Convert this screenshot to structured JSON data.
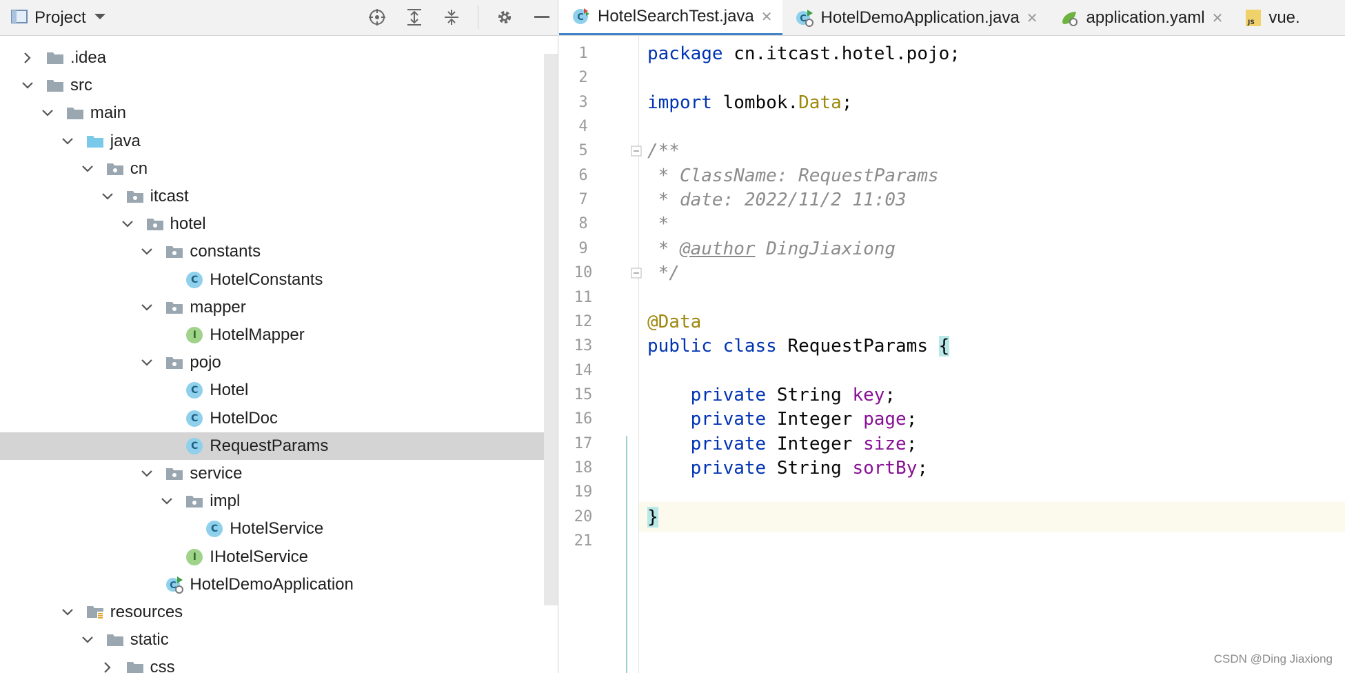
{
  "project_panel": {
    "title": "Project",
    "tree": [
      {
        "label": ".idea",
        "depth": 0,
        "expanded": false,
        "icon": "folder-icon"
      },
      {
        "label": "src",
        "depth": 0,
        "expanded": true,
        "icon": "folder-icon"
      },
      {
        "label": "main",
        "depth": 1,
        "expanded": true,
        "icon": "folder-icon"
      },
      {
        "label": "java",
        "depth": 2,
        "expanded": true,
        "icon": "source-folder-icon"
      },
      {
        "label": "cn",
        "depth": 3,
        "expanded": true,
        "icon": "package-icon"
      },
      {
        "label": "itcast",
        "depth": 4,
        "expanded": true,
        "icon": "package-icon"
      },
      {
        "label": "hotel",
        "depth": 5,
        "expanded": true,
        "icon": "package-icon"
      },
      {
        "label": "constants",
        "depth": 6,
        "expanded": true,
        "icon": "package-icon"
      },
      {
        "label": "HotelConstants",
        "depth": 7,
        "expanded": null,
        "icon": "class-icon"
      },
      {
        "label": "mapper",
        "depth": 6,
        "expanded": true,
        "icon": "package-icon"
      },
      {
        "label": "HotelMapper",
        "depth": 7,
        "expanded": null,
        "icon": "interface-icon"
      },
      {
        "label": "pojo",
        "depth": 6,
        "expanded": true,
        "icon": "package-icon"
      },
      {
        "label": "Hotel",
        "depth": 7,
        "expanded": null,
        "icon": "class-icon"
      },
      {
        "label": "HotelDoc",
        "depth": 7,
        "expanded": null,
        "icon": "class-icon"
      },
      {
        "label": "RequestParams",
        "depth": 7,
        "expanded": null,
        "icon": "class-icon",
        "selected": true
      },
      {
        "label": "service",
        "depth": 6,
        "expanded": true,
        "icon": "package-icon"
      },
      {
        "label": "impl",
        "depth": 7,
        "expanded": true,
        "icon": "package-icon"
      },
      {
        "label": "HotelService",
        "depth": 8,
        "expanded": null,
        "icon": "class-icon"
      },
      {
        "label": "IHotelService",
        "depth": 7,
        "expanded": null,
        "icon": "interface-icon"
      },
      {
        "label": "HotelDemoApplication",
        "depth": 6,
        "expanded": null,
        "icon": "spring-app-icon"
      },
      {
        "label": "resources",
        "depth": 2,
        "expanded": true,
        "icon": "resources-folder-icon"
      },
      {
        "label": "static",
        "depth": 3,
        "expanded": true,
        "icon": "folder-icon"
      },
      {
        "label": "css",
        "depth": 4,
        "expanded": false,
        "icon": "folder-icon"
      }
    ]
  },
  "tabs": [
    {
      "label": "HotelSearchTest.java",
      "icon": "test-class-icon",
      "active": true
    },
    {
      "label": "HotelDemoApplication.java",
      "icon": "spring-app-icon",
      "active": false
    },
    {
      "label": "application.yaml",
      "icon": "yaml-icon",
      "active": false
    },
    {
      "label": "vue.",
      "icon": "js-file-icon",
      "active": false
    }
  ],
  "close_glyph": "✕",
  "code": {
    "line_numbers": [
      "1",
      "2",
      "3",
      "4",
      "5",
      "6",
      "7",
      "8",
      "9",
      "10",
      "11",
      "12",
      "13",
      "14",
      "15",
      "16",
      "17",
      "18",
      "19",
      "20",
      "21"
    ],
    "current_line": 20,
    "lines": [
      [
        {
          "t": "package",
          "c": "kw"
        },
        {
          "t": " cn.itcast.hotel.pojo;",
          "c": ""
        }
      ],
      [],
      [
        {
          "t": "import",
          "c": "kw"
        },
        {
          "t": " lombok.",
          "c": ""
        },
        {
          "t": "Data",
          "c": "ann"
        },
        {
          "t": ";",
          "c": ""
        }
      ],
      [],
      [
        {
          "t": "/**",
          "c": "cmt"
        }
      ],
      [
        {
          "t": " * ClassName: RequestParams",
          "c": "cmt"
        }
      ],
      [
        {
          "t": " * date: 2022/11/2 11:03",
          "c": "cmt"
        }
      ],
      [
        {
          "t": " *",
          "c": "cmt"
        }
      ],
      [
        {
          "t": " * ",
          "c": "cmt"
        },
        {
          "t": "@author",
          "c": "tag"
        },
        {
          "t": " DingJiaxiong",
          "c": "cmt"
        }
      ],
      [
        {
          "t": " */",
          "c": "cmt"
        }
      ],
      [],
      [
        {
          "t": "@Data",
          "c": "ann"
        }
      ],
      [
        {
          "t": "public class",
          "c": "kw"
        },
        {
          "t": " RequestParams ",
          "c": ""
        },
        {
          "t": "{",
          "c": "brace-hl"
        }
      ],
      [],
      [
        {
          "t": "    ",
          "c": ""
        },
        {
          "t": "private",
          "c": "kw"
        },
        {
          "t": " String ",
          "c": ""
        },
        {
          "t": "key",
          "c": "fld"
        },
        {
          "t": ";",
          "c": ""
        }
      ],
      [
        {
          "t": "    ",
          "c": ""
        },
        {
          "t": "private",
          "c": "kw"
        },
        {
          "t": " Integer ",
          "c": ""
        },
        {
          "t": "page",
          "c": "fld"
        },
        {
          "t": ";",
          "c": ""
        }
      ],
      [
        {
          "t": "    ",
          "c": ""
        },
        {
          "t": "private",
          "c": "kw"
        },
        {
          "t": " Integer ",
          "c": ""
        },
        {
          "t": "size",
          "c": "fld"
        },
        {
          "t": ";",
          "c": ""
        }
      ],
      [
        {
          "t": "    ",
          "c": ""
        },
        {
          "t": "private",
          "c": "kw"
        },
        {
          "t": " String ",
          "c": ""
        },
        {
          "t": "sortBy",
          "c": "fld"
        },
        {
          "t": ";",
          "c": ""
        }
      ],
      [],
      [
        {
          "t": "}",
          "c": "brace-hl"
        }
      ],
      []
    ]
  },
  "watermark": "CSDN @Ding Jiaxiong",
  "colors": {
    "keyword": "#0033b3",
    "annotation": "#9e880d",
    "comment": "#8c8c8c",
    "field": "#871094",
    "selection": "#d4d4d4",
    "active_tab_underline": "#4083c9"
  }
}
